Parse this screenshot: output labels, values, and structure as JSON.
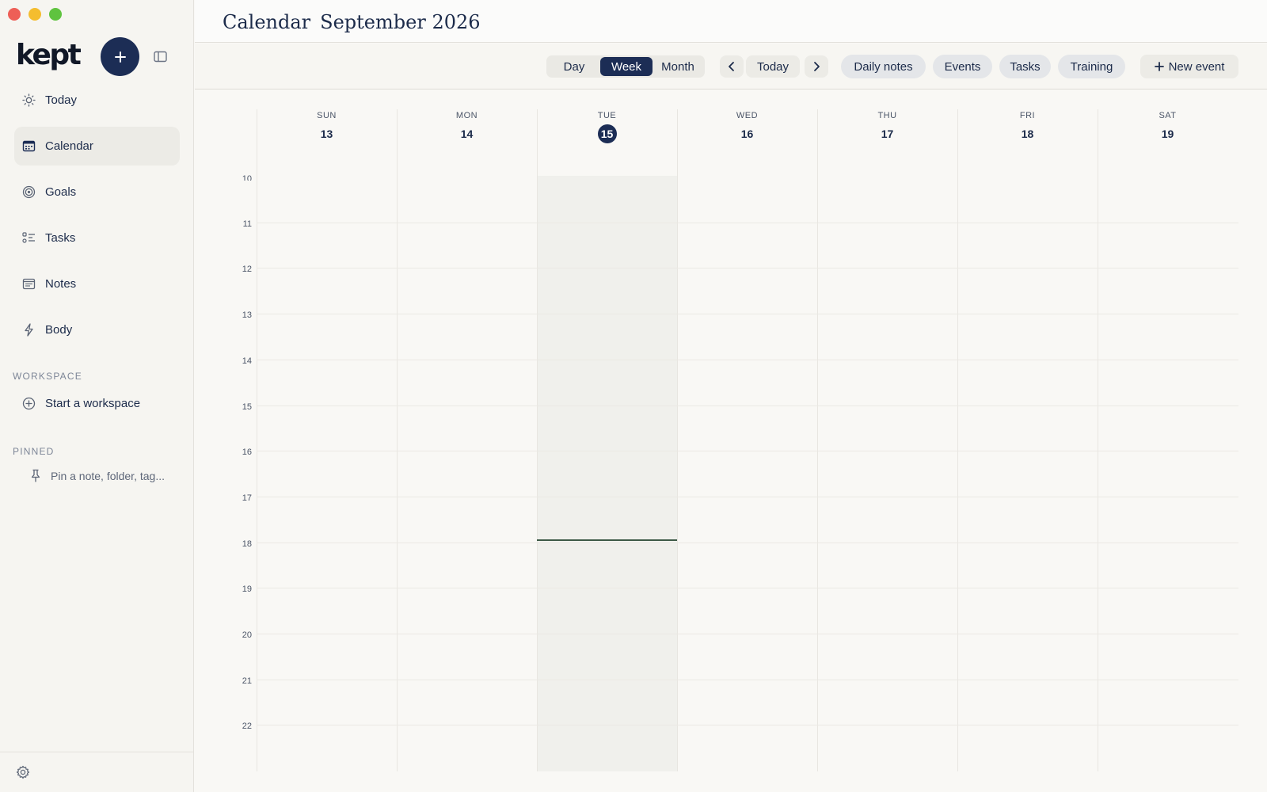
{
  "window": {
    "controls": [
      "close",
      "minimize",
      "zoom"
    ]
  },
  "sidebar": {
    "logo": "kept",
    "nav": [
      {
        "label": "Today",
        "icon": "sun-icon"
      },
      {
        "label": "Calendar",
        "icon": "calendar-icon",
        "active": true
      },
      {
        "label": "Goals",
        "icon": "target-icon"
      },
      {
        "label": "Tasks",
        "icon": "task-list-icon"
      },
      {
        "label": "Notes",
        "icon": "note-icon"
      },
      {
        "label": "Body",
        "icon": "bolt-icon"
      }
    ],
    "workspace": {
      "heading": "WORKSPACE",
      "action": "Start a workspace"
    },
    "pinned": {
      "heading": "PINNED",
      "placeholder": "Pin a note, folder, tag..."
    }
  },
  "header": {
    "title": "Calendar",
    "period": "September 2026"
  },
  "toolbar": {
    "views": [
      "Day",
      "Week",
      "Month"
    ],
    "active_view": "Week",
    "today": "Today",
    "filters": [
      "Daily notes",
      "Events",
      "Tasks",
      "Training"
    ],
    "new_event": "New event"
  },
  "calendar": {
    "days": [
      {
        "name": "SUN",
        "date": "13"
      },
      {
        "name": "MON",
        "date": "14"
      },
      {
        "name": "TUE",
        "date": "15",
        "today": true
      },
      {
        "name": "WED",
        "date": "16"
      },
      {
        "name": "THU",
        "date": "17"
      },
      {
        "name": "FRI",
        "date": "18"
      },
      {
        "name": "SAT",
        "date": "19"
      }
    ],
    "hours": [
      "10",
      "11",
      "12",
      "13",
      "14",
      "15",
      "16",
      "17",
      "18",
      "19",
      "20",
      "21",
      "22"
    ],
    "current_time_hour": 18
  },
  "colors": {
    "accent": "#1c2d55",
    "now_line": "#3d5a47",
    "background": "#f9f8f5"
  }
}
